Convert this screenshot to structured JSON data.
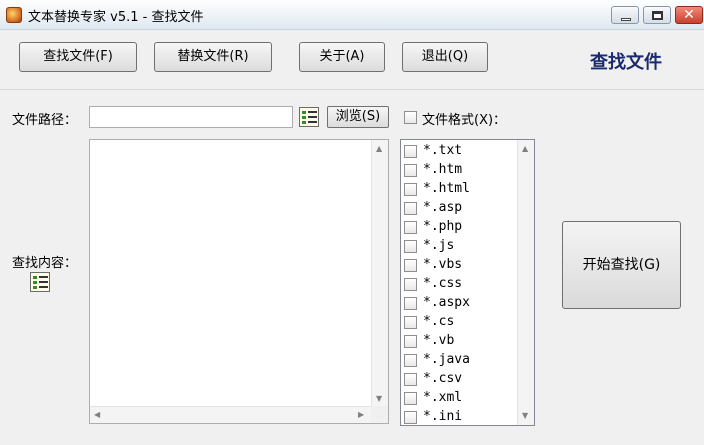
{
  "window": {
    "title": "文本替换专家 v5.1  -  查找文件",
    "close_glyph": "✕"
  },
  "toolbar": {
    "find_files": "查找文件(F)",
    "replace_files": "替换文件(R)",
    "about": "关于(A)",
    "exit": "退出(Q)",
    "page_title": "查找文件"
  },
  "path": {
    "label": "文件路径：",
    "value": "",
    "browse": "浏览(S)"
  },
  "format": {
    "label": "文件格式(X)："
  },
  "content": {
    "label": "查找内容：",
    "value": ""
  },
  "formats": [
    "*.txt",
    "*.htm",
    "*.html",
    "*.asp",
    "*.php",
    "*.js",
    "*.vbs",
    "*.css",
    "*.aspx",
    "*.cs",
    "*.vb",
    "*.java",
    "*.csv",
    "*.xml",
    "*.ini"
  ],
  "start_button": "开始查找(G)",
  "arrows": {
    "up": "▲",
    "down": "▼",
    "left": "◀",
    "right": "▶"
  }
}
